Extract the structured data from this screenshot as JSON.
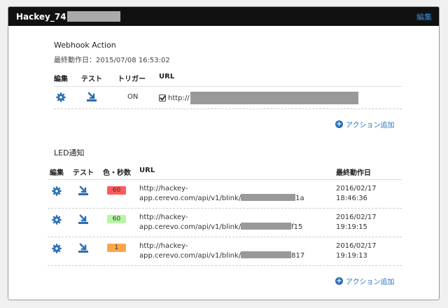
{
  "header": {
    "title": "Hackey_74",
    "edit_label": "編集"
  },
  "webhook": {
    "title": "Webhook Action",
    "last_run": "最終動作日：2015/07/08 16:53:02",
    "columns": [
      "編集",
      "テスト",
      "トリガー",
      "URL"
    ],
    "row": {
      "trigger": "ON",
      "url_prefix": "http://"
    },
    "add_label": "アクション追加"
  },
  "led": {
    "title": "LED通知",
    "columns": [
      "編集",
      "テスト",
      "色・秒数",
      "URL",
      "最終動作日"
    ],
    "rows": [
      {
        "badge": "60",
        "badge_color": "#ff5a5a",
        "url_line1": "http://hackey-",
        "url_line2_prefix": "app.cerevo.com/api/v1/blink/",
        "url_line2_suffix": "1a",
        "date": "2016/02/17",
        "time": "18:46:36"
      },
      {
        "badge": "60",
        "badge_color": "#b6f5a6",
        "url_line1": "http://hackey-",
        "url_line2_prefix": "app.cerevo.com/api/v1/blink/",
        "url_line2_suffix": "f15",
        "date": "2016/02/17",
        "time": "19:19:15"
      },
      {
        "badge": "1",
        "badge_color": "#ffa54a",
        "url_line1": "http://hackey-",
        "url_line2_prefix": "app.cerevo.com/api/v1/blink/",
        "url_line2_suffix": "817",
        "date": "2016/02/17",
        "time": "19:19:13"
      }
    ],
    "add_label": "アクション追加"
  },
  "icons": {
    "edit": "gear-icon",
    "test": "download-arrow-icon",
    "check": "checkbox-icon",
    "add": "plus-circle-icon"
  },
  "colors": {
    "link": "#2a75c0",
    "gear": "#2a6fb5",
    "header_bg": "#111111"
  }
}
